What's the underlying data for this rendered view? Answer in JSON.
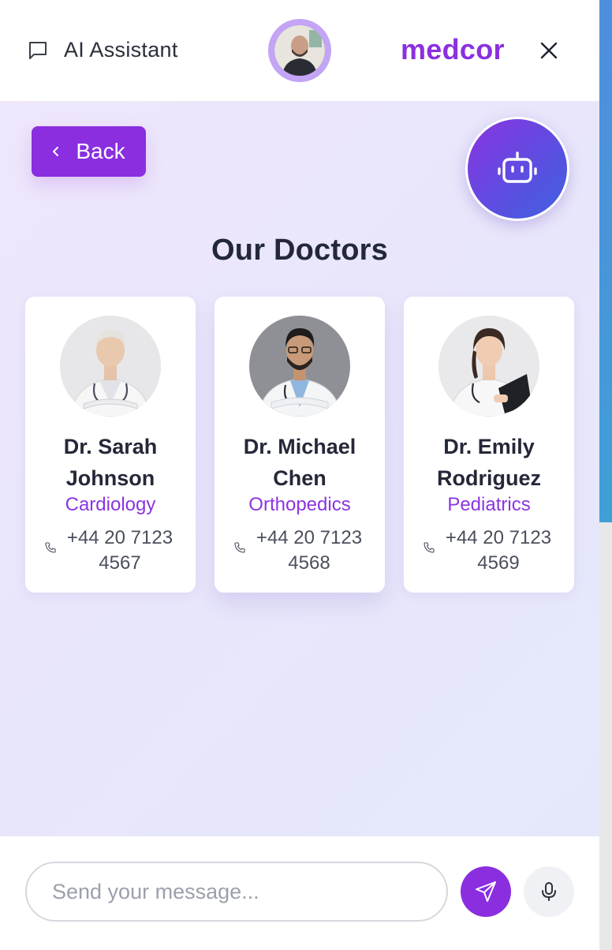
{
  "header": {
    "title": "AI Assistant",
    "brand": "medcor",
    "chat_icon": "message-square-icon",
    "close_icon": "close-icon"
  },
  "main": {
    "back_label": "Back",
    "section_title": "Our Doctors",
    "bot_icon": "bot-icon"
  },
  "doctors": [
    {
      "name": "Dr. Sarah Johnson",
      "specialty": "Cardiology",
      "phone": "+44 20 7123 4567"
    },
    {
      "name": "Dr. Michael Chen",
      "specialty": "Orthopedics",
      "phone": "+44 20 7123 4568"
    },
    {
      "name": "Dr. Emily Rodriguez",
      "specialty": "Pediatrics",
      "phone": "+44 20 7123 4569"
    }
  ],
  "footer": {
    "input_placeholder": "Send your message...",
    "input_value": "",
    "send_icon": "send-icon",
    "mic_icon": "microphone-icon"
  },
  "colors": {
    "accent": "#8a2ee0",
    "title_text": "#232838",
    "specialty_text": "#8b35e0"
  }
}
